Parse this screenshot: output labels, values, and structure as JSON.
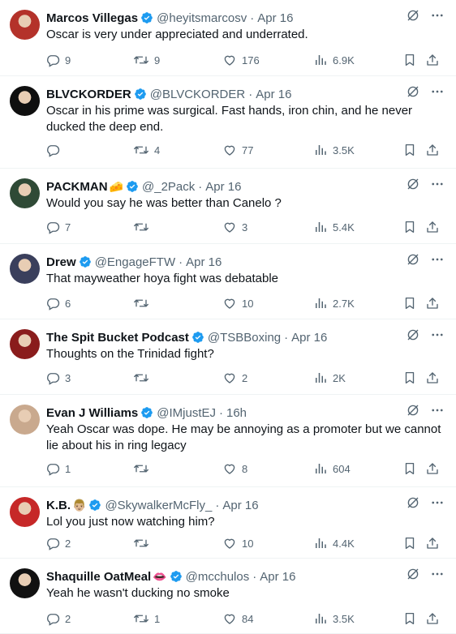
{
  "tweets": [
    {
      "name": "Marcos Villegas",
      "emoji": "",
      "handle": "@heyitsmarcosv",
      "time": "Apr 16",
      "text": "Oscar is very under appreciated and underrated.",
      "replies": "9",
      "retweets": "9",
      "likes": "176",
      "views": "6.9K",
      "avatar_color": "#b4322a"
    },
    {
      "name": "BLVCKORDER",
      "emoji": "",
      "handle": "@BLVCKORDER",
      "time": "Apr 16",
      "text": "Oscar in his prime was surgical. Fast hands, iron chin, and he never ducked the deep end.",
      "replies": "",
      "retweets": "4",
      "likes": "77",
      "views": "3.5K",
      "avatar_color": "#0f0f0f"
    },
    {
      "name": "PACKMAN",
      "emoji": "🧀",
      "handle": "@_2Pack",
      "time": "Apr 16",
      "text": "Would you say he was better than Canelo ?",
      "replies": "7",
      "retweets": "",
      "likes": "3",
      "views": "5.4K",
      "avatar_color": "#2f4a36"
    },
    {
      "name": "Drew",
      "emoji": "",
      "handle": "@EngageFTW",
      "time": "Apr 16",
      "text": "That mayweather hoya fight was debatable",
      "replies": "6",
      "retweets": "",
      "likes": "10",
      "views": "2.7K",
      "avatar_color": "#3a3f5c"
    },
    {
      "name": "The Spit Bucket Podcast",
      "emoji": "",
      "handle": "@TSBBoxing",
      "time": "Apr 16",
      "text": "Thoughts on the Trinidad fight?",
      "replies": "3",
      "retweets": "",
      "likes": "2",
      "views": "2K",
      "avatar_color": "#8a1c1c"
    },
    {
      "name": "Evan J Williams",
      "emoji": "",
      "handle": "@IMjustEJ",
      "time": "16h",
      "text": "Yeah Oscar was dope. He may be annoying as a promoter but we cannot lie about his in ring legacy",
      "replies": "1",
      "retweets": "",
      "likes": "8",
      "views": "604",
      "avatar_color": "#c9a98e"
    },
    {
      "name": "K.B.",
      "emoji": "👨🏼",
      "handle": "@SkywalkerMcFly_",
      "time": "Apr 16",
      "text": "Lol you just now watching him?",
      "replies": "2",
      "retweets": "",
      "likes": "10",
      "views": "4.4K",
      "avatar_color": "#c62828"
    },
    {
      "name": "Shaquille OatMeal",
      "emoji": "👄",
      "handle": "@mcchulos",
      "time": "Apr 16",
      "text": "Yeah he wasn't ducking no smoke",
      "replies": "2",
      "retweets": "1",
      "likes": "84",
      "views": "3.5K",
      "avatar_color": "#111111"
    }
  ],
  "colors": {
    "verified": "#1d9bf0",
    "muted": "#536471",
    "text": "#0f1419"
  },
  "icons": {
    "verified": "verified-badge-icon",
    "grok": "grok-icon",
    "more": "more-icon",
    "reply": "reply-icon",
    "retweet": "retweet-icon",
    "like": "like-icon",
    "views": "views-icon",
    "bookmark": "bookmark-icon",
    "share": "share-icon"
  }
}
